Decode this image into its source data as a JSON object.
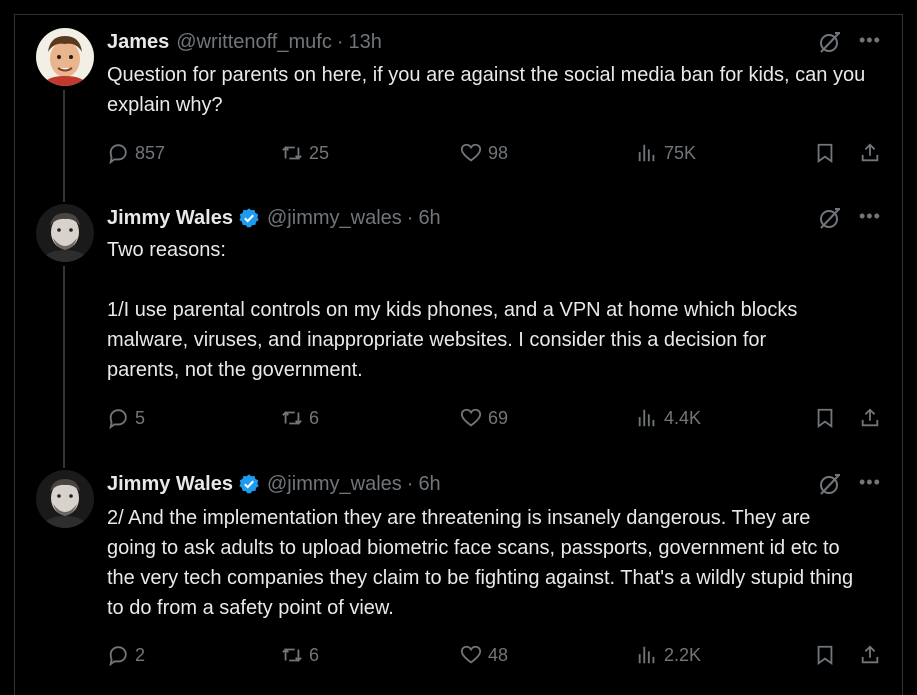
{
  "tweets": [
    {
      "name": "James",
      "verified": false,
      "handle": "@writtenoff_mufc",
      "separator": "·",
      "time": "13h",
      "text": [
        "Question for parents on here, if you are against the social media ban for kids, can you explain why?"
      ],
      "replies": "857",
      "reposts": "25",
      "likes": "98",
      "views": "75K"
    },
    {
      "name": "Jimmy Wales",
      "verified": true,
      "handle": "@jimmy_wales",
      "separator": "·",
      "time": "6h",
      "text": [
        "Two reasons:",
        "",
        "1/I use parental controls on my kids phones, and a VPN at home which blocks malware, viruses, and inappropriate websites.  I consider this a decision for parents, not the government."
      ],
      "replies": "5",
      "reposts": "6",
      "likes": "69",
      "views": "4.4K"
    },
    {
      "name": "Jimmy Wales",
      "verified": true,
      "handle": "@jimmy_wales",
      "separator": "·",
      "time": "6h",
      "text": [
        "2/ And the implementation they are threatening is insanely dangerous.  They are going to ask adults to upload biometric face scans, passports, government id etc to the very tech companies they claim to be fighting against.  That's a wildly stupid thing to do from a safety point of view."
      ],
      "replies": "2",
      "reposts": "6",
      "likes": "48",
      "views": "2.2K"
    }
  ],
  "colors": {
    "background": "#000000",
    "text": "#e7e9ea",
    "muted": "#71767b",
    "verified": "#1d9bf0",
    "thread_line": "#333639"
  },
  "icons": [
    "reply-icon",
    "repost-icon",
    "like-icon",
    "views-icon",
    "bookmark-icon",
    "share-icon",
    "grok-icon",
    "more-icon",
    "verified-badge-icon"
  ]
}
